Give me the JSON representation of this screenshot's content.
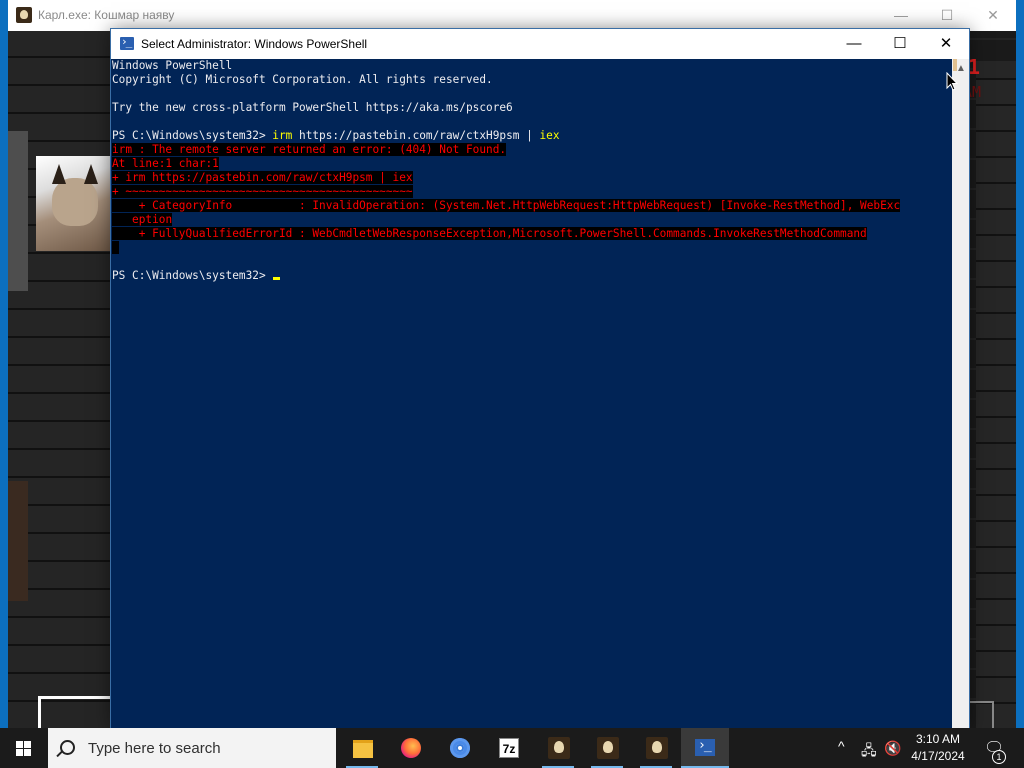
{
  "game_window": {
    "title": "Карл.exe: Кошмар наяву",
    "minimize": "—",
    "maximize": "☐",
    "close": "✕",
    "clock_label": "t1",
    "clock_sub": "AM"
  },
  "powershell": {
    "title": "Select Administrator: Windows PowerShell",
    "minimize": "—",
    "maximize": "☐",
    "close": "✕",
    "scroll_up": "▲",
    "lines": {
      "l1": "Windows PowerShell",
      "l2": "Copyright (C) Microsoft Corporation. All rights reserved.",
      "l4": "Try the new cross-platform PowerShell https://aka.ms/pscore6",
      "prompt1": "PS C:\\Windows\\system32> ",
      "cmd1_name": "irm",
      "cmd1_arg": " https://pastebin.com/raw/ctxH9psm | ",
      "cmd1_pipe": "iex",
      "err1": "irm : The remote server returned an error: (404) Not Found.",
      "err2": "At line:1 char:1",
      "err3": "+ irm https://pastebin.com/raw/ctxH9psm | iex",
      "err4": "+ ~~~~~~~~~~~~~~~~~~~~~~~~~~~~~~~~~~~~~~~~~~~",
      "err5_pad": "    ",
      "err5": "+ CategoryInfo          : InvalidOperation: (System.Net.HttpWebRequest:HttpWebRequest) [Invoke-RestMethod], WebExc",
      "err6_pad": "   ",
      "err6": "eption",
      "err7_pad": "    ",
      "err7": "+ FullyQualifiedErrorId : WebCmdletWebResponseException,Microsoft.PowerShell.Commands.InvokeRestMethodCommand",
      "err8": " ",
      "prompt2": "PS C:\\Windows\\system32> "
    }
  },
  "taskbar": {
    "search_placeholder": "Type here to search",
    "apps": [
      {
        "name": "file-explorer",
        "icon": "folder-icon"
      },
      {
        "name": "firefox",
        "icon": "firefox-icon"
      },
      {
        "name": "chromium",
        "icon": "chrome-icon"
      },
      {
        "name": "7-zip",
        "icon": "7zip-icon",
        "label": "7z"
      },
      {
        "name": "karl-game-1",
        "icon": "game-icon"
      },
      {
        "name": "karl-game-2",
        "icon": "game-icon"
      },
      {
        "name": "karl-game-3",
        "icon": "game-icon"
      },
      {
        "name": "powershell",
        "icon": "powershell-icon",
        "active": true
      }
    ],
    "tray": {
      "chevron": "^",
      "network": "🖧",
      "volume": "🔇",
      "time": "3:10 AM",
      "date": "4/17/2024",
      "notifications": "🗨",
      "notification_count": "1"
    }
  },
  "colors": {
    "console_bg": "#012456",
    "console_fg": "#eeedf0",
    "console_cmd": "#ffff00",
    "console_error": "#ff0000",
    "taskbar_bg": "#1b1b1b",
    "accent": "#76b9ed"
  }
}
